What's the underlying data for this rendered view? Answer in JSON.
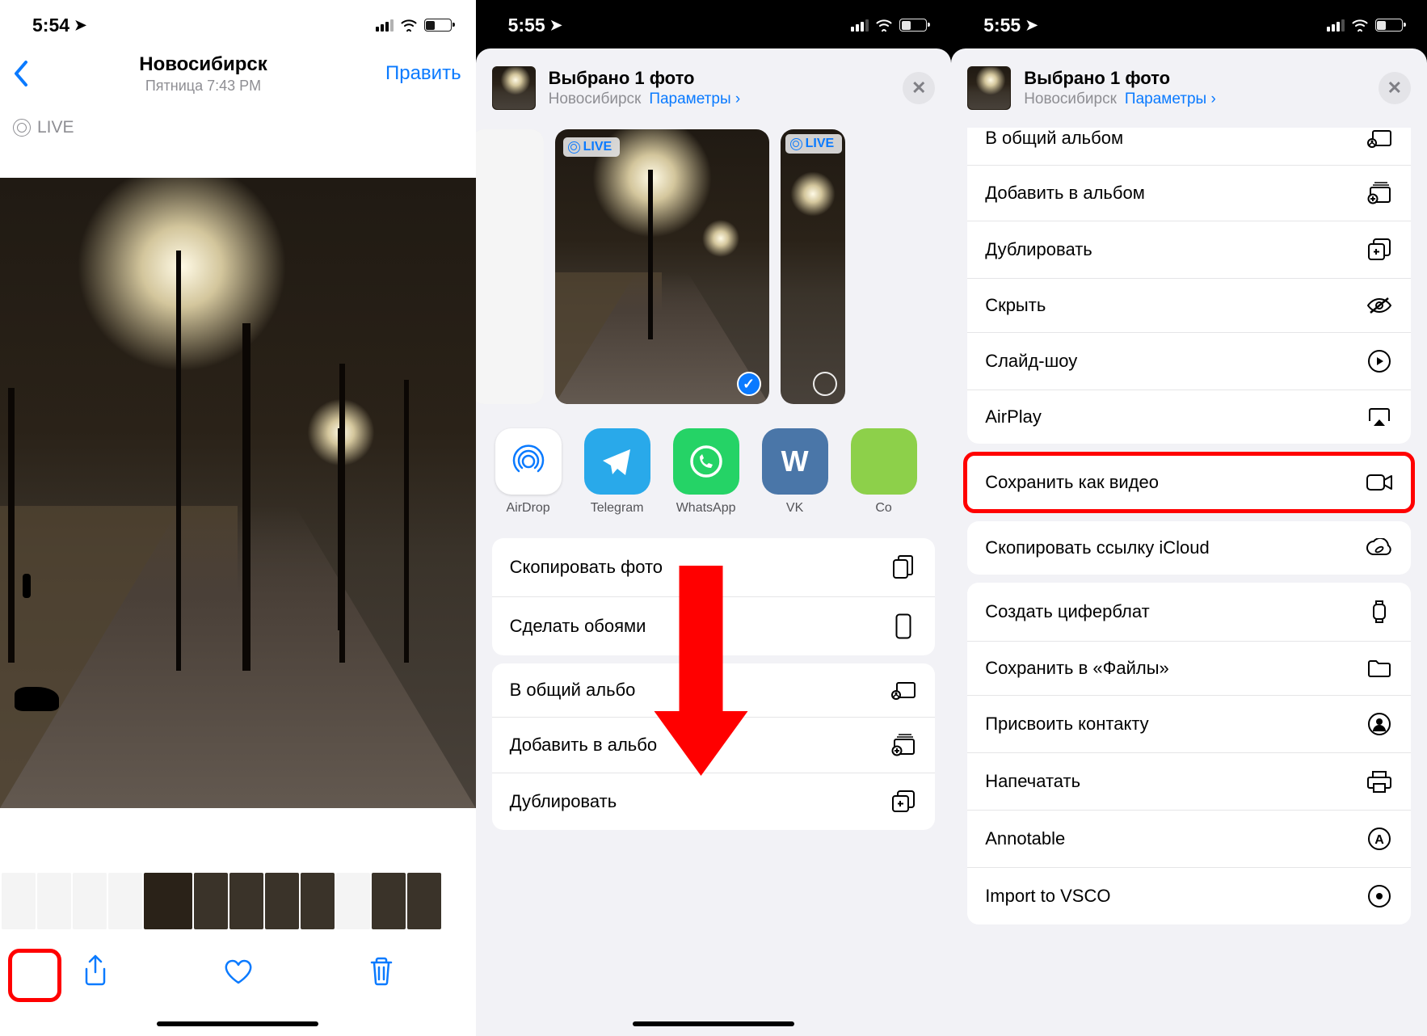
{
  "status": {
    "time1": "5:54",
    "time2": "5:55",
    "time3": "5:55"
  },
  "screen1": {
    "header_title": "Новосибирск",
    "header_sub": "Пятница 7:43 PM",
    "edit": "Править",
    "live": "LIVE"
  },
  "share_header": {
    "title": "Выбрано 1 фото",
    "location": "Новосибирск",
    "params": "Параметры"
  },
  "live_badge": "LIVE",
  "apps": [
    {
      "id": "airdrop",
      "label": "AirDrop"
    },
    {
      "id": "telegram",
      "label": "Telegram"
    },
    {
      "id": "whatsapp",
      "label": "WhatsApp"
    },
    {
      "id": "vk",
      "label": "VK"
    },
    {
      "id": "other",
      "label": "Co"
    }
  ],
  "s2_actions_g1": [
    {
      "label": "Скопировать фото",
      "icon": "copy"
    },
    {
      "label": "Сделать обоями",
      "icon": "phone"
    }
  ],
  "s2_actions_g2": [
    {
      "label": "В общий альбо",
      "icon": "shared-album"
    },
    {
      "label": "Добавить в альбо",
      "icon": "add-album"
    },
    {
      "label": "Дублировать",
      "icon": "duplicate"
    }
  ],
  "s3_actions_g1": [
    {
      "label": "В общий альбом",
      "icon": "shared-album"
    },
    {
      "label": "Добавить в альбом",
      "icon": "add-album"
    },
    {
      "label": "Дублировать",
      "icon": "duplicate"
    },
    {
      "label": "Скрыть",
      "icon": "hide"
    },
    {
      "label": "Слайд-шоу",
      "icon": "play"
    },
    {
      "label": "AirPlay",
      "icon": "airplay"
    }
  ],
  "s3_action_highlight": {
    "label": "Сохранить как видео",
    "icon": "video"
  },
  "s3_actions_g1b": [
    {
      "label": "Скопировать ссылку iCloud",
      "icon": "cloud"
    }
  ],
  "s3_actions_g2": [
    {
      "label": "Создать циферблат",
      "icon": "watch"
    },
    {
      "label": "Сохранить в «Файлы»",
      "icon": "folder"
    },
    {
      "label": "Присвоить контакту",
      "icon": "contact"
    },
    {
      "label": "Напечатать",
      "icon": "print"
    },
    {
      "label": "Annotable",
      "icon": "annotable"
    },
    {
      "label": "Import to VSCO",
      "icon": "vsco"
    }
  ]
}
